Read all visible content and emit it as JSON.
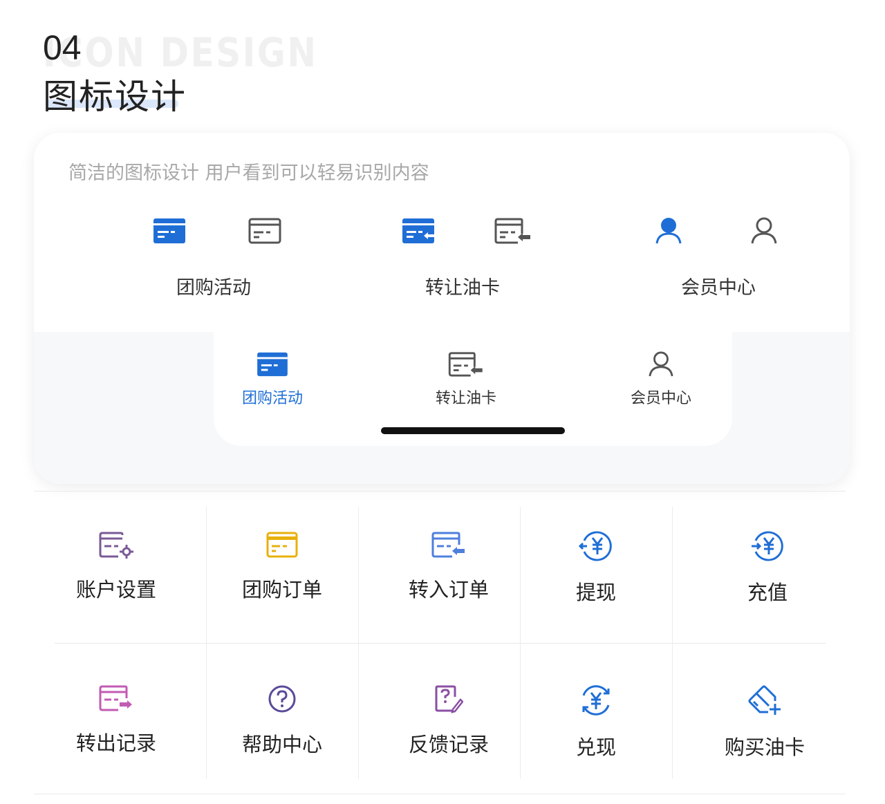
{
  "header": {
    "bg_text": "ICON DESIGN",
    "number": "04",
    "title": "图标设计"
  },
  "card": {
    "subtitle": "简洁的图标设计 用户看到可以轻易识别内容",
    "groups": [
      {
        "label": "团购活动",
        "icons": [
          "card-filled-icon",
          "card-outline-icon"
        ]
      },
      {
        "label": "转让油卡",
        "icons": [
          "card-transfer-filled-icon",
          "card-transfer-outline-icon"
        ]
      },
      {
        "label": "会员中心",
        "icons": [
          "user-filled-icon",
          "user-outline-icon"
        ]
      }
    ],
    "tabs": [
      {
        "label": "团购活动",
        "icon": "card-filled-icon",
        "active": true
      },
      {
        "label": "转让油卡",
        "icon": "card-transfer-outline-icon",
        "active": false
      },
      {
        "label": "会员中心",
        "icon": "user-outline-icon",
        "active": false
      }
    ]
  },
  "grid": [
    {
      "label": "账户设置",
      "icon": "card-settings-icon",
      "color": "#7a5a96"
    },
    {
      "label": "团购订单",
      "icon": "card-order-icon",
      "color": "#e8b00c"
    },
    {
      "label": "转入订单",
      "icon": "card-in-icon",
      "color": "#4e7fdc"
    },
    {
      "label": "提现",
      "icon": "yuan-withdraw-icon",
      "color": "#1f6ed6"
    },
    {
      "label": "充值",
      "icon": "yuan-recharge-icon",
      "color": "#1f6ed6"
    },
    {
      "label": "转出记录",
      "icon": "card-out-icon",
      "color": "#c25bb3"
    },
    {
      "label": "帮助中心",
      "icon": "help-icon",
      "color": "#5b4a99"
    },
    {
      "label": "反馈记录",
      "icon": "feedback-icon",
      "color": "#8a4fa3"
    },
    {
      "label": "兑现",
      "icon": "yuan-exchange-icon",
      "color": "#1f6ed6"
    },
    {
      "label": "购买油卡",
      "icon": "buy-card-icon",
      "color": "#1f6ed6"
    }
  ],
  "colors": {
    "accent": "#1f6ed6",
    "icon_gray": "#555555"
  }
}
